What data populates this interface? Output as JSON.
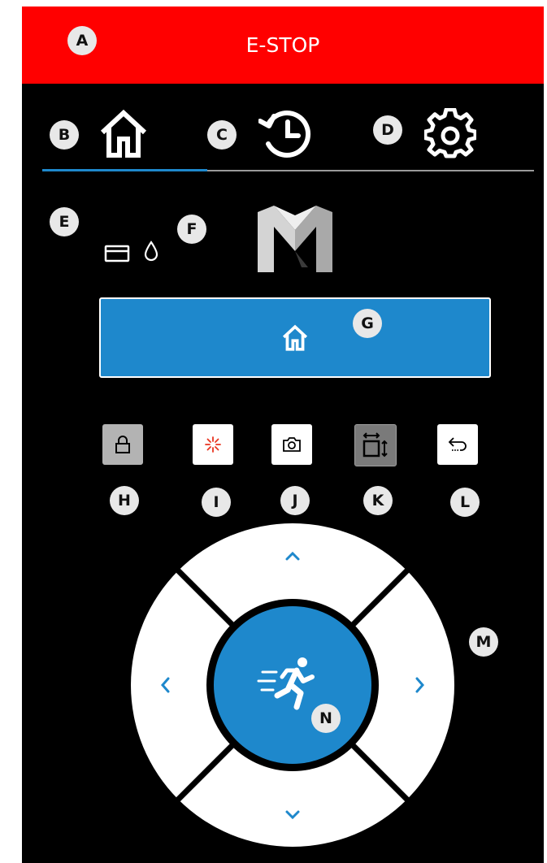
{
  "estop": {
    "label": "E-STOP"
  },
  "badges": {
    "a": "A",
    "b": "B",
    "c": "C",
    "d": "D",
    "e": "E",
    "f": "F",
    "g": "G",
    "h": "H",
    "i": "I",
    "j": "J",
    "k": "K",
    "l": "L",
    "m": "M",
    "n": "N"
  },
  "tabs": [
    {
      "icon": "home-icon",
      "active": true
    },
    {
      "icon": "history-icon",
      "active": false
    },
    {
      "icon": "gear-icon",
      "active": false
    }
  ],
  "status": {
    "icons": [
      "card-icon",
      "droplet-icon"
    ],
    "logo": "m-logo"
  },
  "home_button": {
    "icon": "home-icon"
  },
  "toolbar": [
    {
      "icon": "lock-icon",
      "style": "gray"
    },
    {
      "icon": "laser-icon",
      "style": "white"
    },
    {
      "icon": "camera-icon",
      "style": "white"
    },
    {
      "icon": "resize-icon",
      "style": "dark-gray"
    },
    {
      "icon": "return-icon",
      "style": "white"
    }
  ],
  "jog": {
    "center_icon": "running-person-icon",
    "directions": [
      "up",
      "right",
      "down",
      "left"
    ]
  },
  "colors": {
    "estop": "#ff0000",
    "accent": "#1e88cc",
    "background": "#000000",
    "badge": "#e8e8e8"
  }
}
